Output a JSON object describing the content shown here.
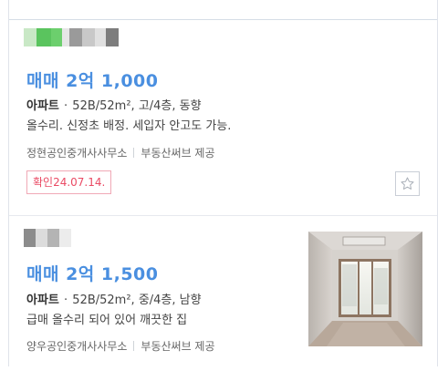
{
  "listings": [
    {
      "price": "매매 2억 1,000",
      "type": "아파트",
      "specs": "52B/52m², 고/4층, 동향",
      "description": "올수리. 신정초 배정. 세입자 안고도 가능.",
      "agent": "정현공인중개사사무소",
      "provider": "부동산써브 제공",
      "confirm_label": "확인24.07.14.",
      "favorite_icon": "star-outline-icon"
    },
    {
      "price": "매매 2억 1,500",
      "type": "아파트",
      "specs": "52B/52m², 중/4층, 남향",
      "description": "급매 올수리 되어 있어 깨끗한 집",
      "agent": "양우공인중개사사무소",
      "provider": "부동산써브 제공",
      "photo_alt": "listing-room-photo"
    }
  ],
  "colors": {
    "price": "#4a8fe0",
    "confirm_badge": "#ea4a64",
    "border": "#dfe3ea"
  }
}
